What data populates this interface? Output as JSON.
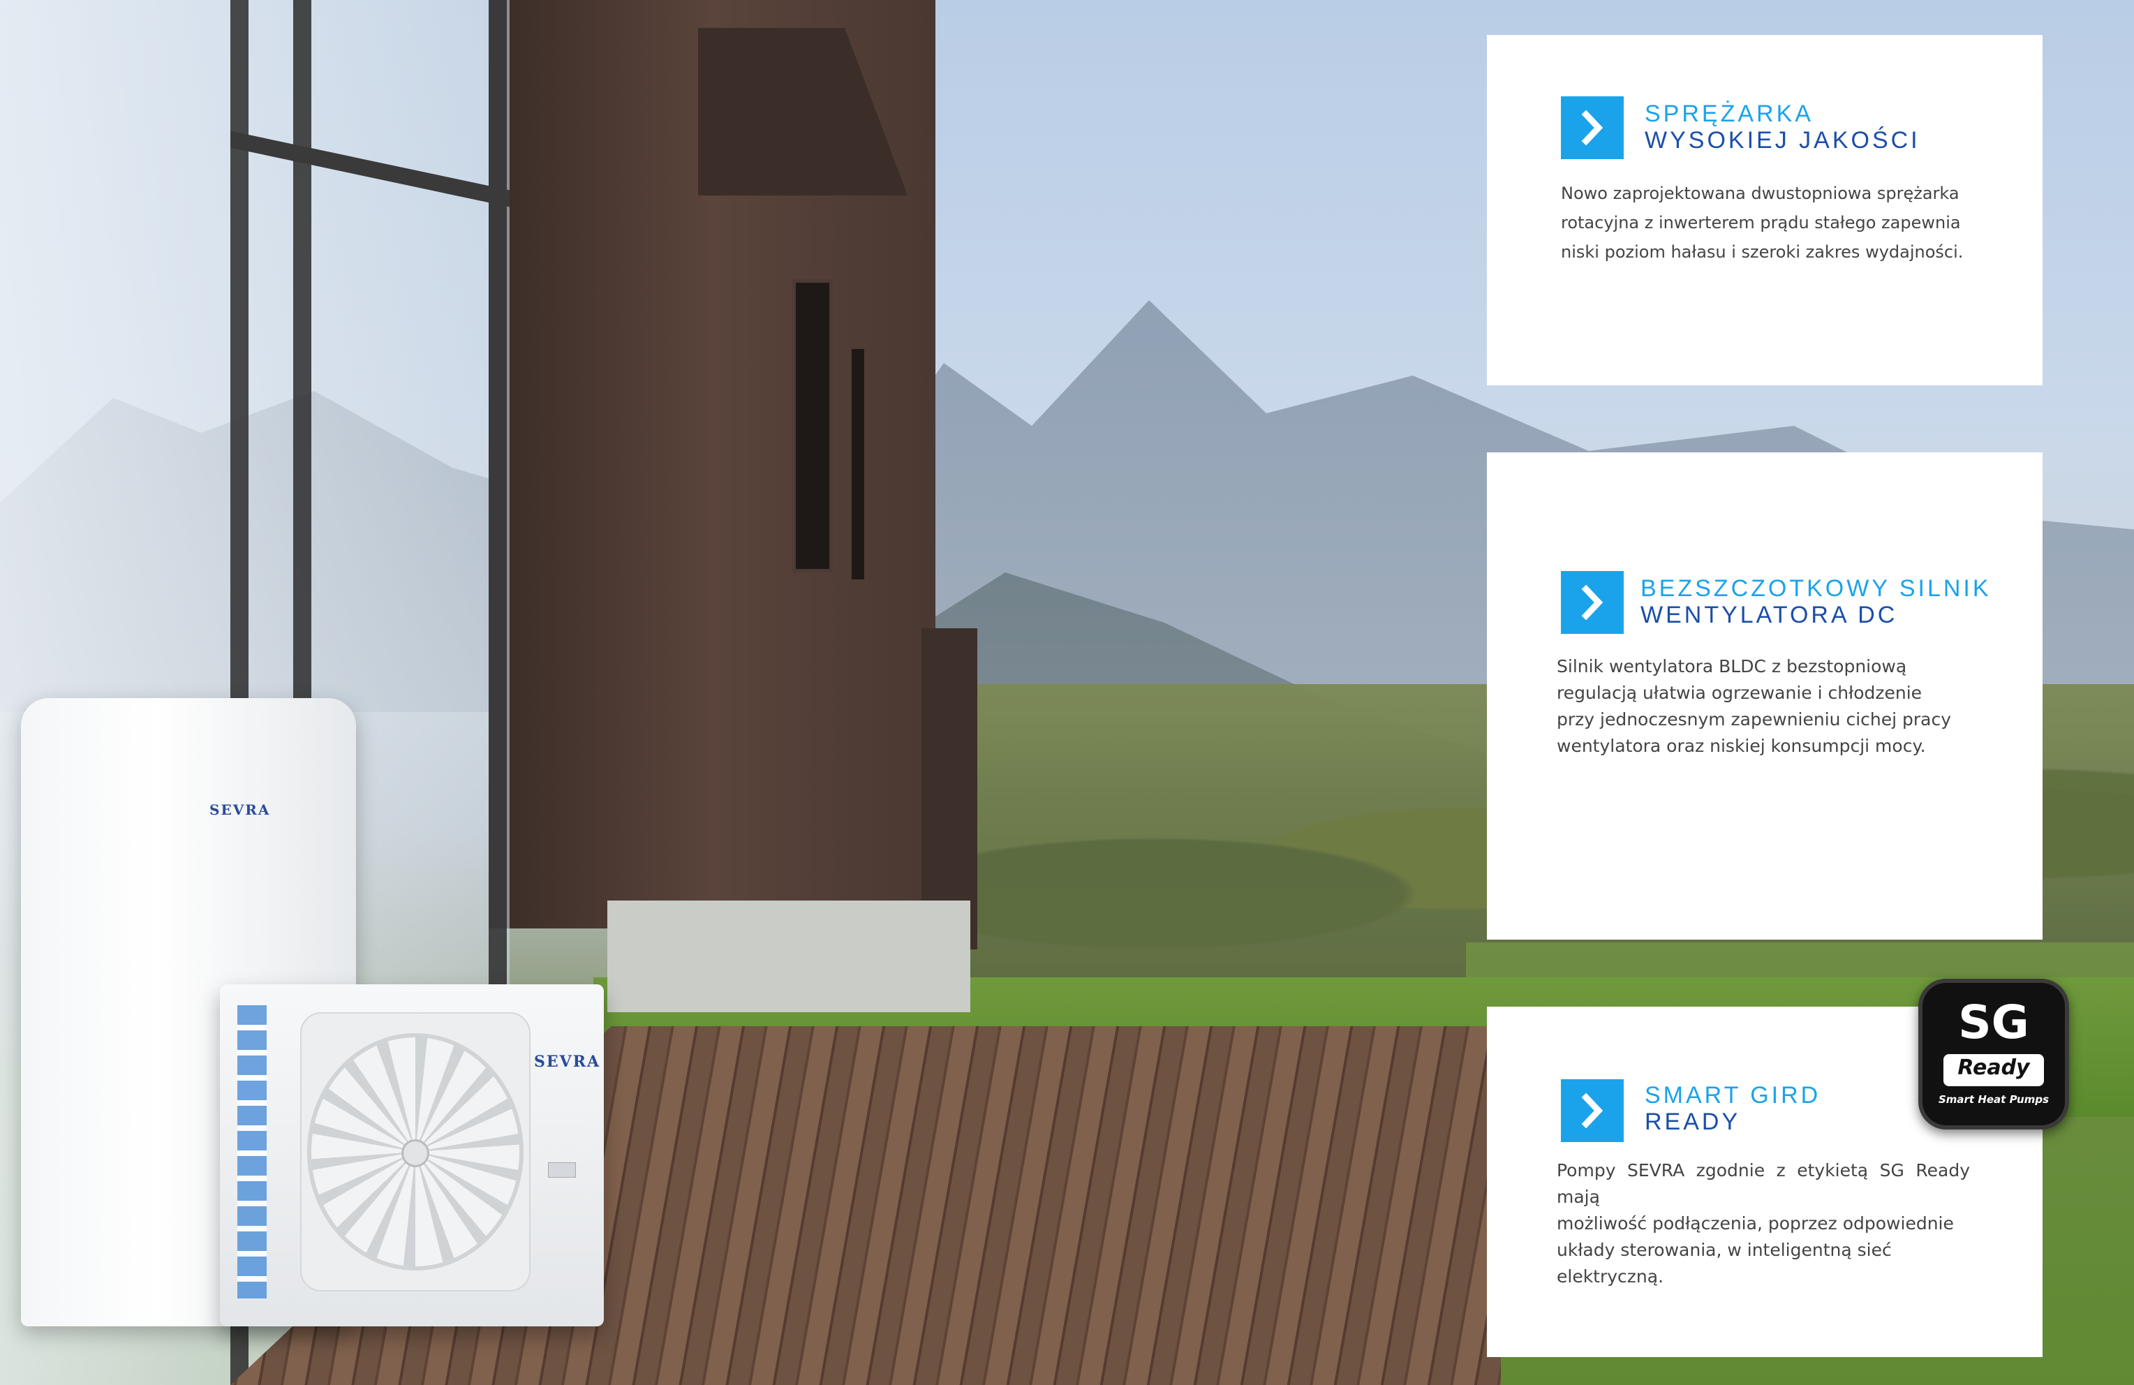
{
  "cards": [
    {
      "title_line1": "SPRĘŻARKA",
      "title_line2": "WYSOKIEJ JAKOŚCI",
      "description_lines": [
        "Nowo zaprojektowana dwustopniowa sprężarka",
        "rotacyjna z inwerterem prądu stałego zapewnia",
        "niski poziom hałasu i  szeroki zakres wydajności."
      ],
      "icon": "chevron-right-icon"
    },
    {
      "title_line1": "BEZSZCZOTKOWY SILNIK",
      "title_line2": "WENTYLATORA DC",
      "description_lines": [
        "Silnik wentylatora BLDC z bezstopniową",
        "regulacją ułatwia ogrzewanie i chłodzenie",
        "przy jednoczesnym zapewnieniu cichej pracy",
        "wentylatora oraz niskiej konsumpcji mocy."
      ],
      "icon": "chevron-right-icon"
    },
    {
      "title_line1": "SMART GIRD",
      "title_line2": "READY",
      "description_lines": [
        "Pompy SEVRA zgodnie z etykietą SG Ready mają",
        "możliwość podłączenia, poprzez odpowiednie",
        "układy sterowania, w inteligentną sieć",
        "elektryczną."
      ],
      "icon": "chevron-right-icon"
    }
  ],
  "badge": {
    "main": "SG",
    "ready": "Ready",
    "sub": "Smart Heat Pumps"
  },
  "units": {
    "brand_tall": "SEVRA",
    "brand_outdoor": "SEVRA"
  },
  "colors": {
    "accent_light": "#1aa3ea",
    "accent_dark": "#1b4ea8",
    "card_bg": "#ffffff"
  }
}
